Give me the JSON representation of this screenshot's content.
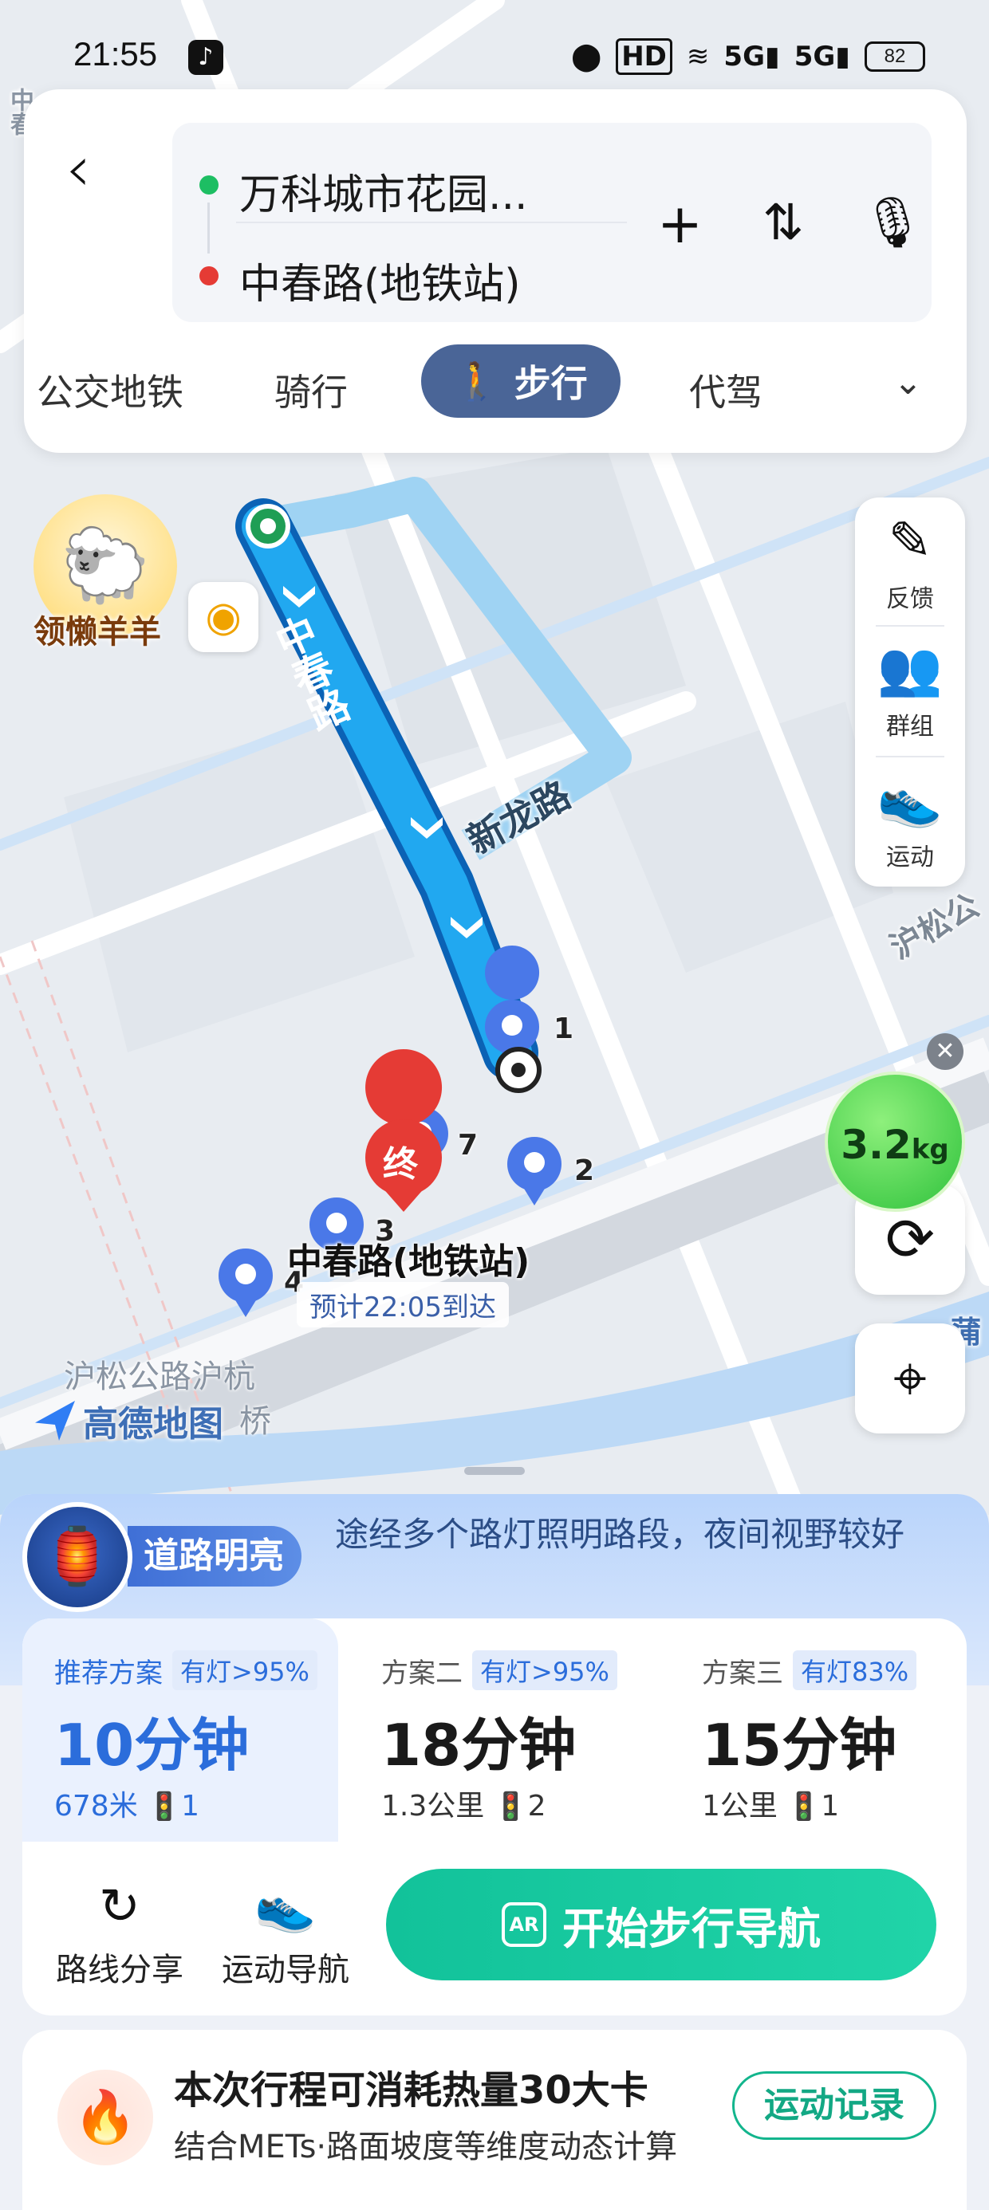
{
  "status_bar": {
    "time": "21:55",
    "icons": [
      "tiktok-icon",
      "location-icon",
      "hd-icon",
      "wifi-icon",
      "5g-signal-icon",
      "5g-signal-icon",
      "battery-icon"
    ],
    "hd": "HD",
    "sig1": "5G",
    "sig2": "5G",
    "battery": "82"
  },
  "route": {
    "from": "万科城市花园...",
    "to": "中春路(地铁站)",
    "from_dot_color": "#1dbe63",
    "to_dot_color": "#e53b35"
  },
  "modes": {
    "transit": "公交地铁",
    "bike": "骑行",
    "walk": "步行",
    "driver": "代驾",
    "active": "walk"
  },
  "map": {
    "road_zhongchun": "中春路",
    "road_xinlong": "新龙路",
    "road_husong": "沪松公",
    "road_partial": "蒲",
    "road_corner": "中春",
    "bridge_line1": "沪松公路沪杭",
    "bridge_line2": "桥",
    "destination_name": "中春路(地铁站)",
    "eta": "预计22:05到达",
    "end_marker": "终",
    "mascot_label": "领懒羊羊",
    "logo": "高德地图",
    "pins": [
      "1",
      "2",
      "3",
      "4",
      "7"
    ],
    "route_color": "#1fa6ee",
    "eco_value": "3.2",
    "eco_unit": "kg"
  },
  "side_tools": {
    "feedback": "反馈",
    "group": "群组",
    "sport": "运动"
  },
  "lamp": {
    "title": "道路明亮",
    "desc": "途经多个路灯照明路段，夜间视野较好"
  },
  "plans": [
    {
      "name": "推荐方案",
      "tag": "有灯>95%",
      "time": "10分钟",
      "distance": "678米",
      "lights": "1"
    },
    {
      "name": "方案二",
      "tag": "有灯>95%",
      "time": "18分钟",
      "distance": "1.3公里",
      "lights": "2"
    },
    {
      "name": "方案三",
      "tag": "有灯83%",
      "time": "15分钟",
      "distance": "1公里",
      "lights": "1"
    }
  ],
  "actions": {
    "share": "路线分享",
    "sport_nav": "运动导航",
    "start": "开始步行导航",
    "ar": "AR"
  },
  "calorie": {
    "title": "本次行程可消耗热量30大卡",
    "subtitle": "结合METs·路面坡度等维度动态计算",
    "button": "运动记录"
  }
}
